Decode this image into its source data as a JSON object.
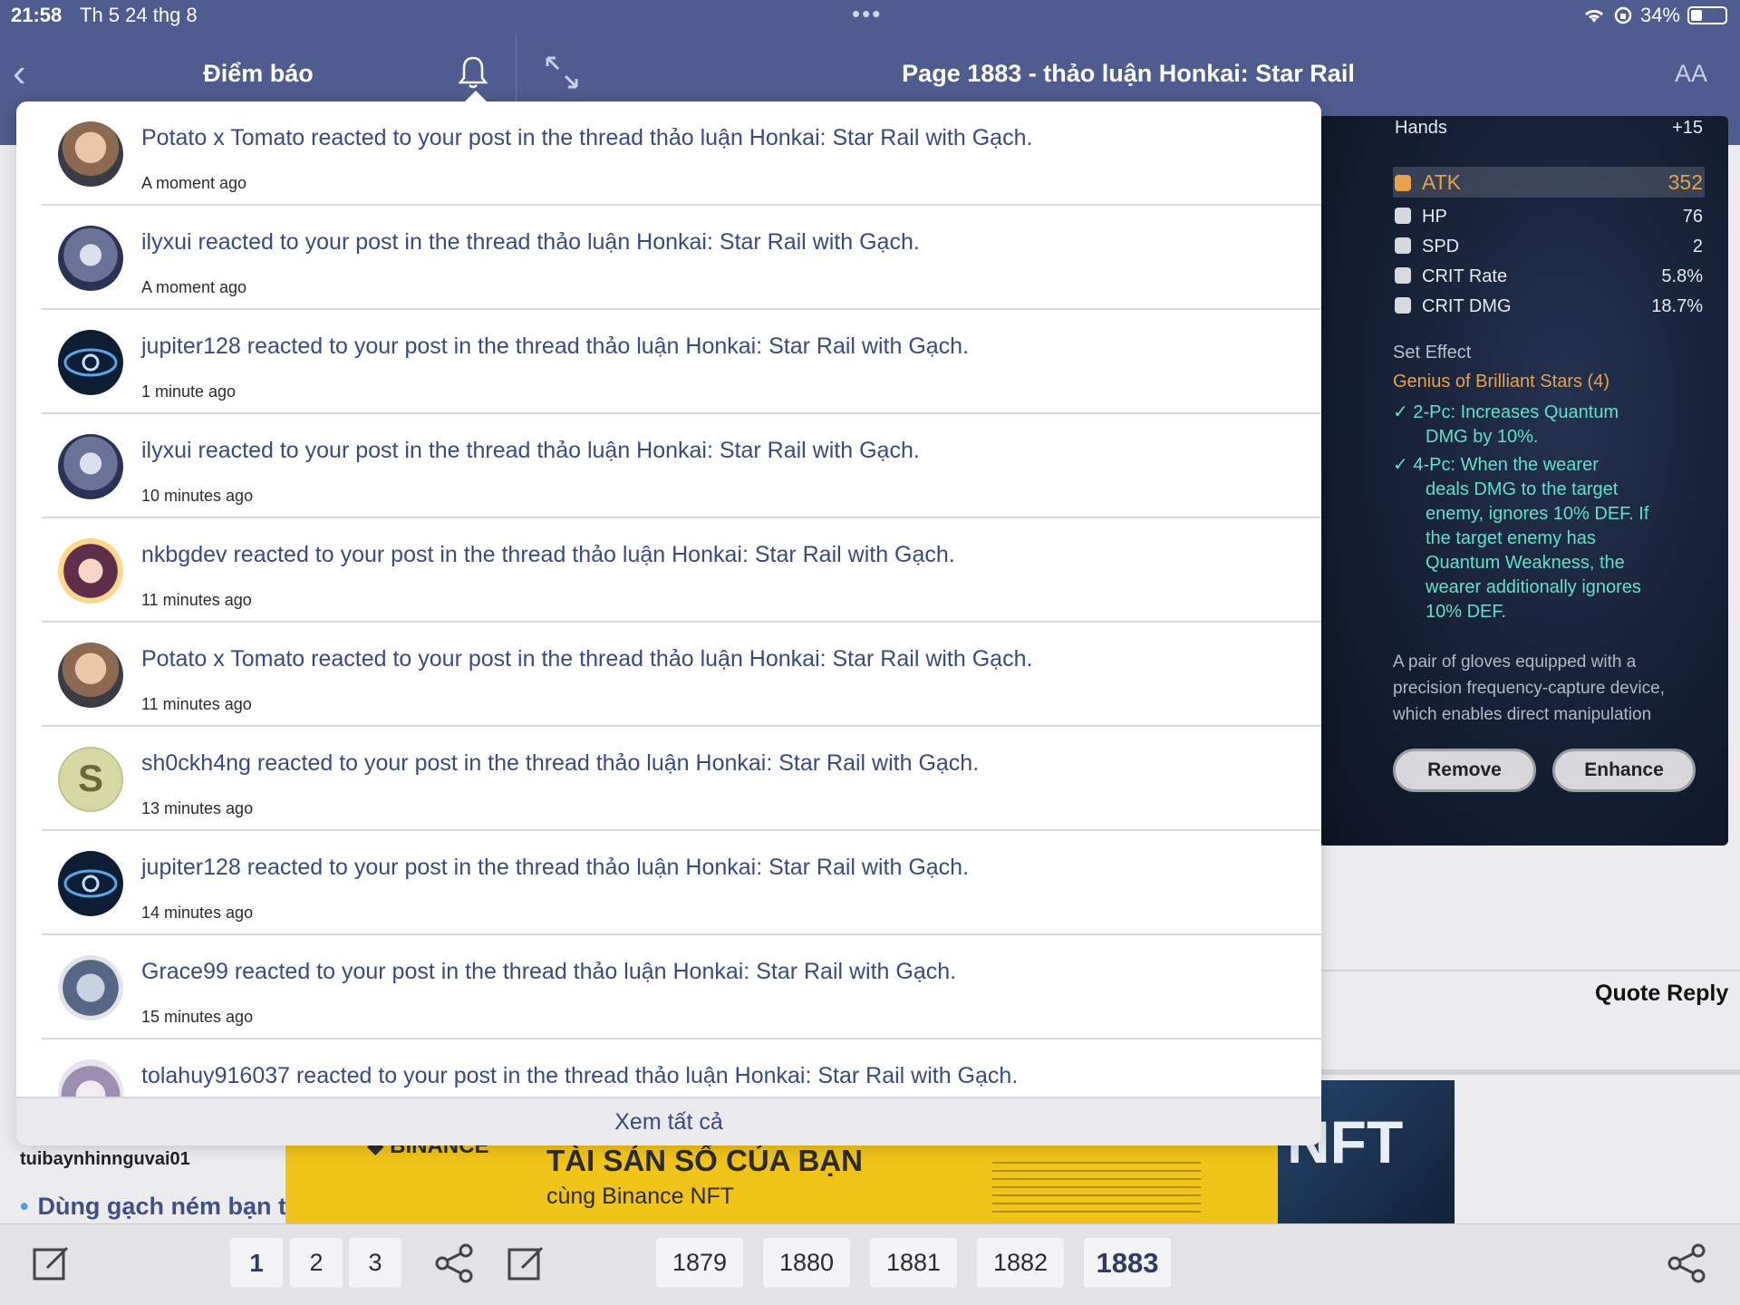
{
  "status": {
    "time": "21:58",
    "date": "Th 5 24 thg 8",
    "battery": "34%"
  },
  "left_nav": {
    "title": "Điểm báo"
  },
  "right_nav": {
    "title": "Page 1883 - thảo luận Honkai: Star Rail",
    "text_size_label": "AA"
  },
  "game_card": {
    "slot": "Hands",
    "level": "+15",
    "main_stat": {
      "name": "ATK",
      "value": "352"
    },
    "sub_stats": [
      {
        "name": "HP",
        "value": "76"
      },
      {
        "name": "SPD",
        "value": "2"
      },
      {
        "name": "CRIT Rate",
        "value": "5.8%"
      },
      {
        "name": "CRIT DMG",
        "value": "18.7%"
      }
    ],
    "set_effect_label": "Set Effect",
    "set_name": "Genius of Brilliant Stars (4)",
    "effect_2pc": [
      "2-Pc: Increases Quantum",
      "DMG by 10%."
    ],
    "effect_4pc": [
      "4-Pc: When the wearer",
      "deals DMG to the target",
      "enemy, ignores 10% DEF. If",
      "the target enemy has",
      "Quantum Weakness, the",
      "wearer additionally ignores",
      "10% DEF."
    ],
    "description": [
      "A pair of gloves equipped with a",
      "precision frequency-capture device,",
      "which enables direct manipulation"
    ],
    "remove_label": "Remove",
    "enhance_label": "Enhance"
  },
  "post_actions": {
    "quote_reply": "Quote Reply"
  },
  "notifications": [
    {
      "user": "Potato x Tomato",
      "text": "Potato x Tomato reacted to your post in the thread thảo luận Honkai: Star Rail with Gạch.",
      "time": "A moment ago",
      "avatar": "potato"
    },
    {
      "user": "ilyxui",
      "text": "ilyxui reacted to your post in the thread thảo luận Honkai: Star Rail with Gạch.",
      "time": "A moment ago",
      "avatar": "ilyxui"
    },
    {
      "user": "jupiter128",
      "text": "jupiter128 reacted to your post in the thread thảo luận Honkai: Star Rail with Gạch.",
      "time": "1 minute ago",
      "avatar": "jupiter"
    },
    {
      "user": "ilyxui",
      "text": "ilyxui reacted to your post in the thread thảo luận Honkai: Star Rail with Gạch.",
      "time": "10 minutes ago",
      "avatar": "ilyxui"
    },
    {
      "user": "nkbgdev",
      "text": "nkbgdev reacted to your post in the thread thảo luận Honkai: Star Rail with Gạch.",
      "time": "11 minutes ago",
      "avatar": "nkb"
    },
    {
      "user": "Potato x Tomato",
      "text": "Potato x Tomato reacted to your post in the thread thảo luận Honkai: Star Rail with Gạch.",
      "time": "11 minutes ago",
      "avatar": "potato"
    },
    {
      "user": "sh0ckh4ng",
      "text": "sh0ckh4ng reacted to your post in the thread thảo luận Honkai: Star Rail with Gạch.",
      "time": "13 minutes ago",
      "avatar": "s",
      "initial": "S"
    },
    {
      "user": "jupiter128",
      "text": "jupiter128 reacted to your post in the thread thảo luận Honkai: Star Rail with Gạch.",
      "time": "14 minutes ago",
      "avatar": "jupiter"
    },
    {
      "user": "Grace99",
      "text": "Grace99 reacted to your post in the thread thảo luận Honkai: Star Rail with Gạch.",
      "time": "15 minutes ago",
      "avatar": "grace"
    },
    {
      "user": "tolahuy916037",
      "text": "tolahuy916037 reacted to your post in the thread thảo luận Honkai: Star Rail with Gạch.",
      "time": "",
      "avatar": "tola"
    }
  ],
  "view_all_label": "Xem tất cả",
  "background_post": {
    "username": "tuibaynhinnguvai01",
    "link_text": "Dùng gạch ném bạn t"
  },
  "ad": {
    "brand": "BINANCE",
    "headline": "TÀI SẢN SỐ CỦA BẠN",
    "subline": "cùng Binance NFT",
    "panel_text": "NFT"
  },
  "pagination": {
    "pages_left": [
      "1",
      "2",
      "3"
    ],
    "pages_right": [
      "1879",
      "1880",
      "1881",
      "1882",
      "1883"
    ],
    "current": "1883"
  },
  "colors": {
    "nav_bg": "#4e5c8f",
    "link": "#3b4a7e",
    "atk_gold": "#e9a14b",
    "set_teal": "#62e0c9"
  }
}
